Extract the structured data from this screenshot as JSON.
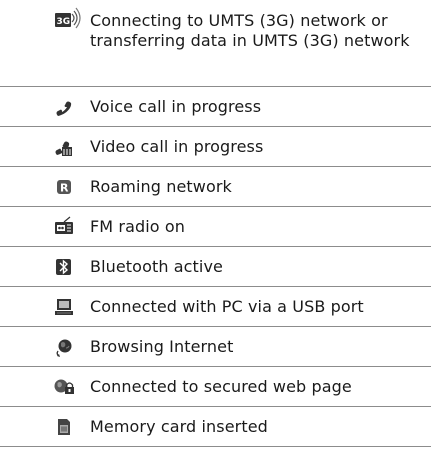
{
  "rows": [
    {
      "icon": "umts-3g-icon",
      "text": "Connecting to UMTS (3G) network or transferring data in UMTS (3G) network"
    },
    {
      "icon": "voice-call-icon",
      "text": "Voice call in progress"
    },
    {
      "icon": "video-call-icon",
      "text": "Video call in progress"
    },
    {
      "icon": "roaming-icon",
      "text": "Roaming network"
    },
    {
      "icon": "fm-radio-icon",
      "text": "FM radio on"
    },
    {
      "icon": "bluetooth-icon",
      "text": "Bluetooth active"
    },
    {
      "icon": "pc-usb-icon",
      "text": "Connected with PC via a USB port"
    },
    {
      "icon": "browsing-internet-icon",
      "text": "Browsing Internet"
    },
    {
      "icon": "secured-web-page-icon",
      "text": "Connected to secured web page"
    },
    {
      "icon": "memory-card-icon",
      "text": "Memory card inserted"
    }
  ]
}
